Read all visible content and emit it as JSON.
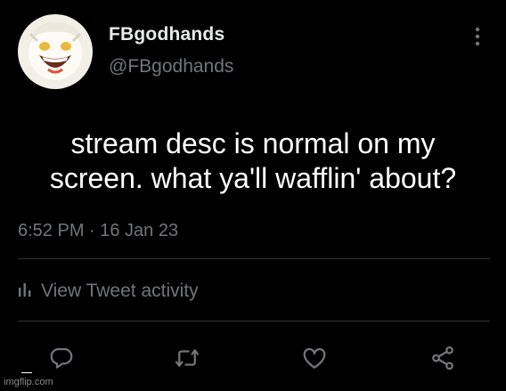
{
  "tweet": {
    "display_name": "FBgodhands",
    "handle": "@FBgodhands",
    "text": "stream desc is normal on my\nscreen. what ya'll wafflin' about?",
    "timestamp": "6:52 PM · 16 Jan 23",
    "activity_label": "View Tweet activity"
  },
  "icons": {
    "avatar": "avatar",
    "more": "more-vertical-icon",
    "activity": "bar-chart-icon",
    "reply": "reply-icon",
    "retweet": "retweet-icon",
    "like": "heart-icon",
    "share": "share-icon"
  },
  "colors": {
    "background": "#000000",
    "text_primary": "#e7e9ea",
    "text_secondary": "#71767b",
    "divider": "#2f3336"
  },
  "watermark": {
    "text": "imgflip.com"
  }
}
